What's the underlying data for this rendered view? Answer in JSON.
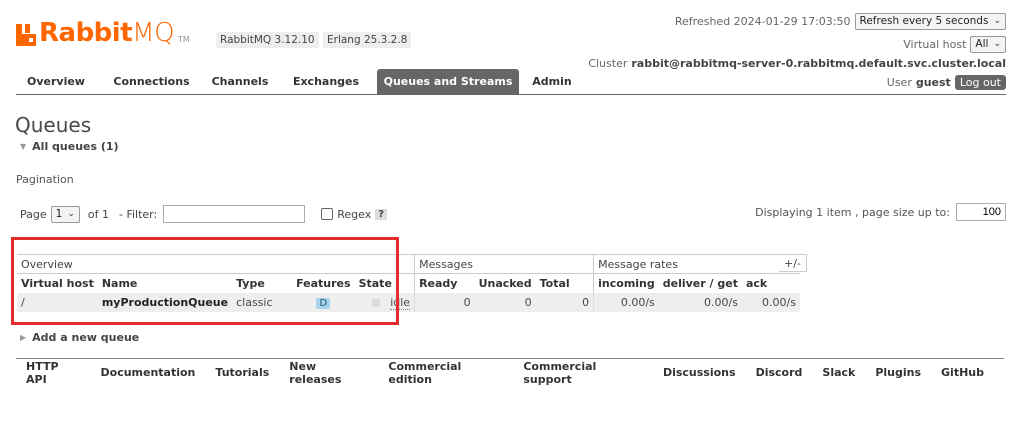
{
  "header": {
    "logo_text_bold": "Rabbit",
    "logo_text_light": "MQ",
    "logo_tm": "TM",
    "rabbitmq_version": "RabbitMQ 3.12.10",
    "erlang_version": "Erlang 25.3.2.8",
    "refreshed_label": "Refreshed 2024-01-29 17:03:50",
    "refresh_select": "Refresh every 5 seconds",
    "vhost_label": "Virtual host",
    "vhost_select": "All",
    "cluster_label": "Cluster",
    "cluster_name": "rabbit@rabbitmq-server-0.rabbitmq.default.svc.cluster.local",
    "user_label": "User",
    "user_name": "guest",
    "logout_label": "Log out"
  },
  "tabs": {
    "overview": "Overview",
    "connections": "Connections",
    "channels": "Channels",
    "exchanges": "Exchanges",
    "queues": "Queues and Streams",
    "admin": "Admin"
  },
  "main": {
    "title": "Queues",
    "all_queues": "All queues (1)",
    "pagination_label": "Pagination",
    "page_label": "Page",
    "page_value": "1",
    "of_label": "of 1",
    "filter_label": "- Filter:",
    "filter_value": "",
    "regex_label": "Regex",
    "regex_help": "?",
    "display_info": "Displaying 1 item , page size up to:",
    "page_size": "100",
    "add_queue": "Add a new queue"
  },
  "table": {
    "groups": {
      "overview": "Overview",
      "messages": "Messages",
      "rates": "Message rates",
      "plusminus": "+/-"
    },
    "columns": {
      "vhost": "Virtual host",
      "name": "Name",
      "type": "Type",
      "features": "Features",
      "state": "State",
      "ready": "Ready",
      "unacked": "Unacked",
      "total": "Total",
      "incoming": "incoming",
      "deliver": "deliver / get",
      "ack": "ack"
    },
    "row": {
      "vhost": "/",
      "name": "myProductionQueue",
      "type": "classic",
      "feature": "D",
      "state": "idle",
      "ready": "0",
      "unacked": "0",
      "total": "0",
      "incoming": "0.00/s",
      "deliver": "0.00/s",
      "ack": "0.00/s"
    }
  },
  "footer": {
    "links": [
      "HTTP API",
      "Documentation",
      "Tutorials",
      "New releases",
      "Commercial edition",
      "Commercial support",
      "Discussions",
      "Discord",
      "Slack",
      "Plugins",
      "GitHub"
    ]
  },
  "colors": {
    "brand": "#ff6600",
    "highlight": "#e52c2c",
    "tab_active": "#666666"
  }
}
